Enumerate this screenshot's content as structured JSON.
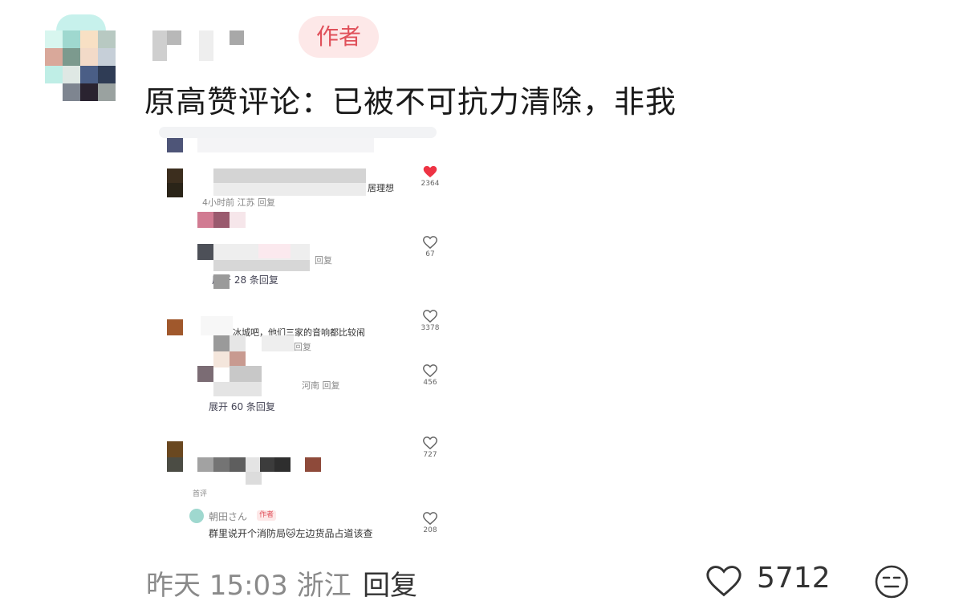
{
  "author_badge": "作者",
  "comment": {
    "text": "原高赞评论：已被不可抗力清除，非我"
  },
  "embedded": {
    "items": [
      {
        "text": "居理想",
        "meta": "4小时前 江苏 回复",
        "likes": "2364",
        "liked": true
      },
      {
        "meta": "回复",
        "likes": "67",
        "liked": false
      },
      {
        "more": "展开 28 条回复"
      },
      {
        "text": "冰城吧，他们三家的音响都比较闹",
        "meta": "回复",
        "likes": "3378",
        "liked": false
      },
      {
        "meta": "河南 回复",
        "likes": "456",
        "liked": false
      },
      {
        "more": "展开 60 条回复"
      },
      {
        "likes": "727",
        "liked": false
      },
      {
        "label": "首评"
      },
      {
        "user": "朝田さん",
        "tag": "作者",
        "text": "群里说开个消防局🐱左边货品占道该查",
        "likes": "208",
        "liked": false
      }
    ]
  },
  "footer": {
    "meta": "昨天 15:03 浙江",
    "reply": "回复",
    "likes": "5712"
  },
  "colors": {
    "accent": "#e0505a",
    "badge_bg": "#fde8e8",
    "like_red": "#ee3344"
  },
  "icons": {
    "like": "heart-outline-icon",
    "liked": "heart-filled-icon",
    "emoji": "neutral-face-icon"
  }
}
